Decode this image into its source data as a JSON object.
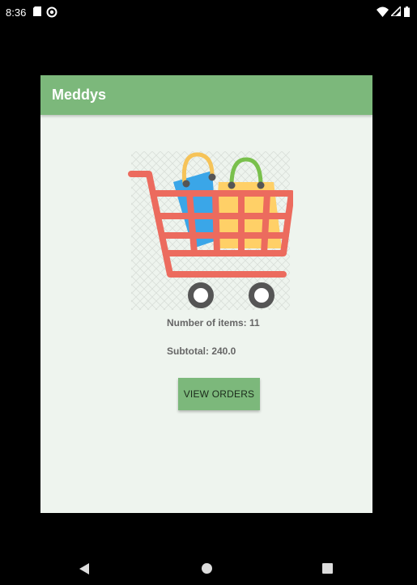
{
  "status_bar": {
    "time": "8:36",
    "icons": [
      "sd-card-icon",
      "block-icon",
      "wifi-icon",
      "signal-icon",
      "battery-icon"
    ]
  },
  "dialog": {
    "title": "Meddys",
    "illustration": "shopping-cart-icon",
    "items_count_text": "Number of items: 11",
    "subtotal_text": "Subtotal: 240.0",
    "button_label": "VIEW ORDERS"
  },
  "colors": {
    "accent": "#7cb87b",
    "dialog_bg": "#eef4ee",
    "cart_red": "#ec6b5e",
    "bag_blue": "#3aa6e8",
    "bag_yellow": "#ffd067",
    "handle_green": "#79c04c",
    "handle_orange": "#f6c358",
    "wheel": "#555555"
  },
  "nav_bar": {
    "buttons": [
      "back-icon",
      "home-icon",
      "recents-icon"
    ]
  }
}
